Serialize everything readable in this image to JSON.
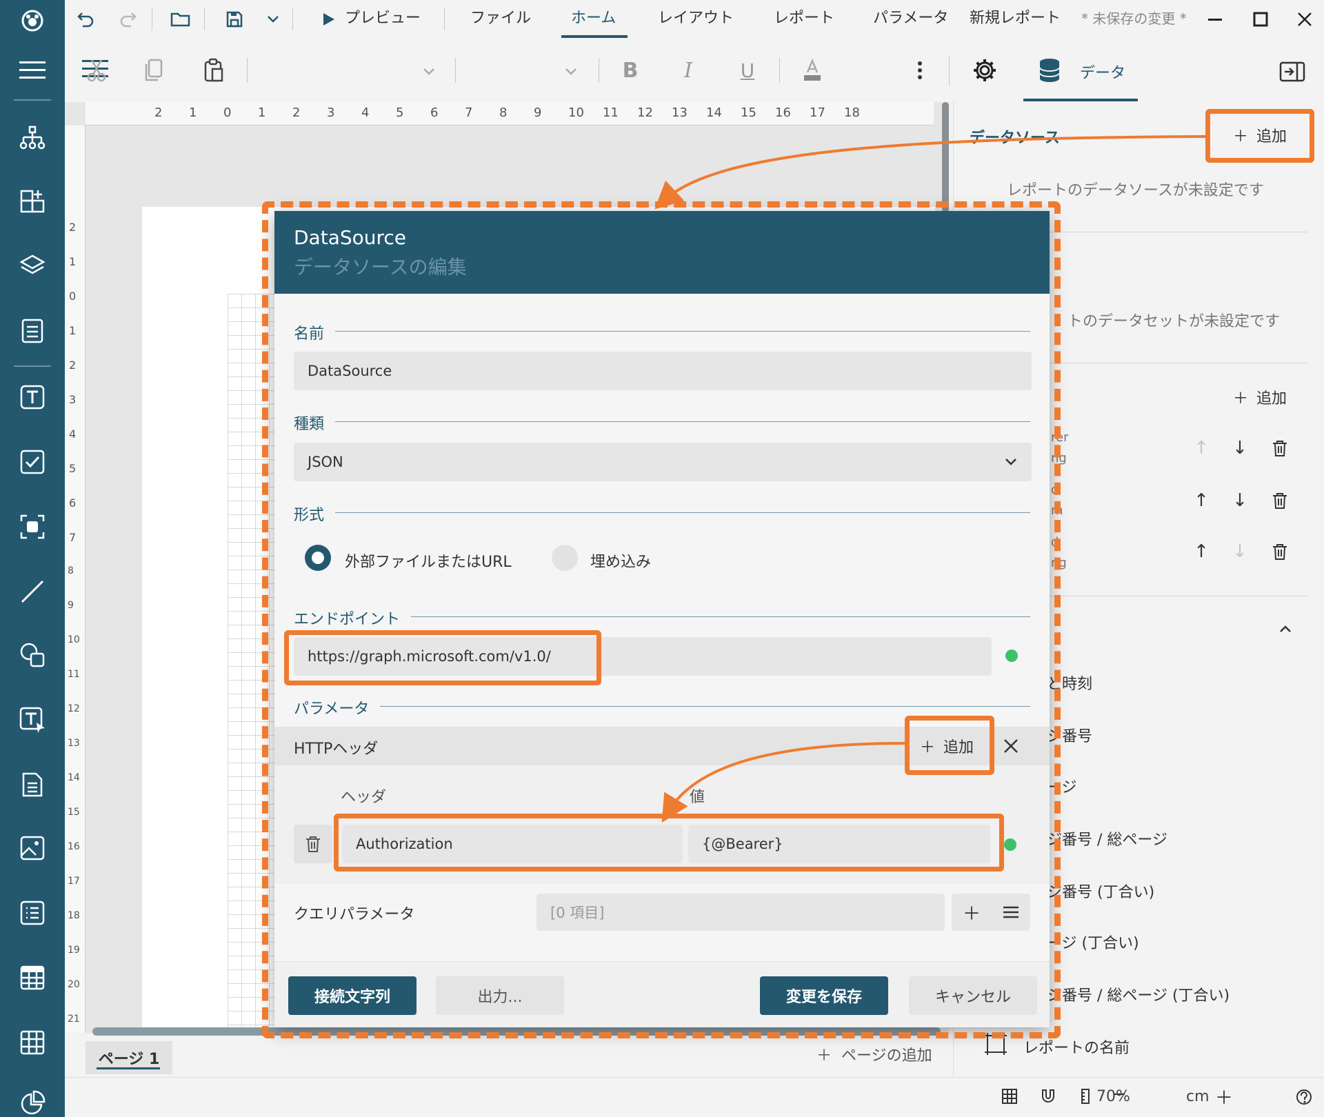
{
  "titlebar": {
    "preview_label": "プレビュー",
    "menu": [
      "ファイル",
      "ホーム",
      "レイアウト",
      "レポート",
      "パラメータ",
      "新規レポート"
    ],
    "unsaved": "* 未保存の変更 *"
  },
  "toolbar": {
    "data_tab_label": "データ"
  },
  "ruler": {
    "top": [
      "2",
      "1",
      "0",
      "1",
      "2",
      "3",
      "4",
      "5",
      "6",
      "7",
      "8",
      "9",
      "10",
      "11",
      "12",
      "13",
      "14",
      "15",
      "16",
      "17",
      "18"
    ],
    "left": [
      "2",
      "1",
      "0",
      "1",
      "2",
      "3",
      "4",
      "5",
      "6",
      "7",
      "8",
      "9",
      "10",
      "11",
      "12",
      "13",
      "14",
      "15",
      "16",
      "17",
      "18",
      "19",
      "20",
      "21"
    ]
  },
  "pagebar": {
    "page_tab": "ページ 1",
    "add_page": "ページの追加"
  },
  "statusbar": {
    "zoom": "70%",
    "unit": "cm"
  },
  "right_panel": {
    "datasource_title": "データソース",
    "add_label": "追加",
    "no_datasource": "レポートのデータソースが未設定です",
    "no_dataset": "トのデータセットが未設定です",
    "param_items_partial": [
      "rer",
      "ng",
      "d",
      "m",
      "d",
      "ng"
    ],
    "items": [
      "と時刻",
      "ジ番号",
      "ージ",
      "ジ番号 / 総ページ",
      "ジ番号 (丁合い)",
      "ージ (丁合い)",
      "ジ番号 / 総ページ (丁合い)",
      "レポートの名前"
    ]
  },
  "dialog": {
    "title": "DataSource",
    "subtitle": "データソースの編集",
    "name_label": "名前",
    "name_value": "DataSource",
    "type_label": "種類",
    "type_value": "JSON",
    "format_label": "形式",
    "radio_external": "外部ファイルまたはURL",
    "radio_embedded": "埋め込み",
    "endpoint_label": "エンドポイント",
    "endpoint_value": "https://graph.microsoft.com/v1.0/",
    "params_label": "パラメータ",
    "http_header_label": "HTTPヘッダ",
    "add_label": "追加",
    "col_header": "ヘッダ",
    "col_value": "値",
    "header_name": "Authorization",
    "header_value": "{@Bearer}",
    "query_label": "クエリパラメータ",
    "query_value": "[0 項目]",
    "btn_connection": "接続文字列",
    "btn_output": "出力...",
    "btn_save": "変更を保存",
    "btn_cancel": "キャンセル"
  },
  "colors": {
    "sidebar": "#23586f",
    "accent": "#23586f",
    "highlight": "#ee7b30",
    "status_ok": "#3cc16a"
  }
}
